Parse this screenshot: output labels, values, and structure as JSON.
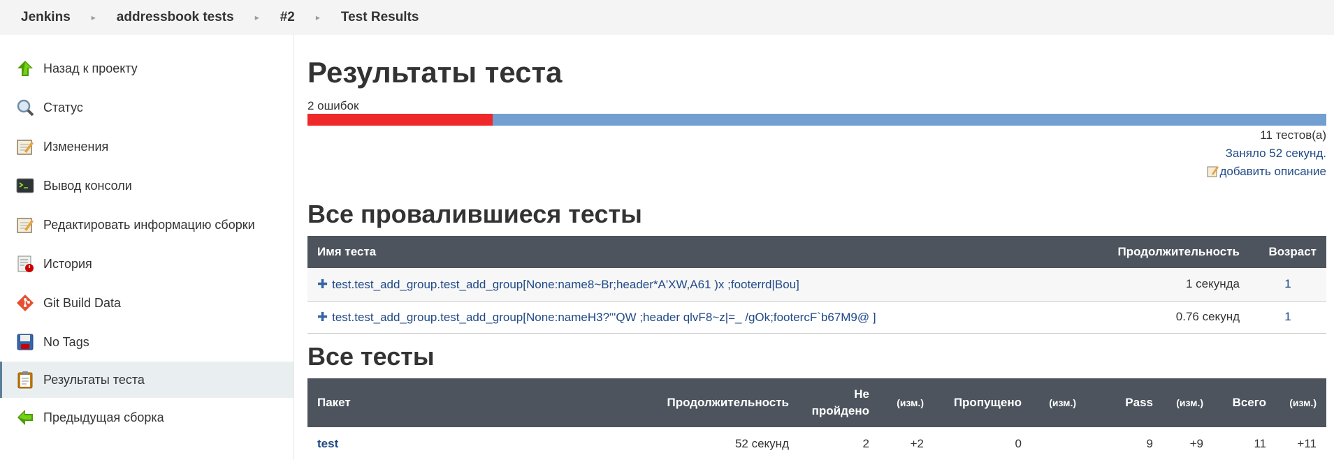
{
  "breadcrumb": {
    "items": [
      "Jenkins",
      "addressbook tests",
      "#2",
      "Test Results"
    ]
  },
  "sidebar": {
    "items": [
      {
        "label": "Назад к проекту",
        "icon": "up-arrow-icon"
      },
      {
        "label": "Статус",
        "icon": "magnifier-icon"
      },
      {
        "label": "Изменения",
        "icon": "notepad-icon"
      },
      {
        "label": "Вывод консоли",
        "icon": "terminal-icon"
      },
      {
        "label": "Редактировать информацию сборки",
        "icon": "notepad-icon"
      },
      {
        "label": "История",
        "icon": "history-icon"
      },
      {
        "label": "Git Build Data",
        "icon": "git-icon"
      },
      {
        "label": "No Tags",
        "icon": "save-icon"
      },
      {
        "label": "Результаты теста",
        "icon": "clipboard-icon"
      },
      {
        "label": "Предыдущая сборка",
        "icon": "left-arrow-icon"
      }
    ],
    "active_index": 8
  },
  "main": {
    "title": "Результаты теста",
    "fail_count_text": "2 ошибок",
    "progress": {
      "failed": 2,
      "total": 11,
      "fail_color": "#ef2929",
      "pass_color": "#729fcf"
    },
    "test_count": "11 тестов(а)",
    "duration": "Заняло 52 секунд.",
    "add_description": "добавить описание"
  },
  "failed_section": {
    "title": "Все провалившиеся тесты",
    "headers": {
      "name": "Имя теста",
      "duration": "Продолжительность",
      "age": "Возраст"
    },
    "rows": [
      {
        "name": "test.test_add_group.test_add_group[None:name8~Br;header*A'XW,A61 )x ;footerrd|Bou]",
        "duration": "1 секунда",
        "age": "1"
      },
      {
        "name": "test.test_add_group.test_add_group[None:nameH3?\"'QW ;header qlvF8~z|=_ /gOk;footercF`b67M9@ ]",
        "duration": "0.76 секунд",
        "age": "1"
      }
    ]
  },
  "all_section": {
    "title": "Все тесты",
    "headers": {
      "package": "Пакет",
      "duration": "Продолжительность",
      "failed_1": "Не",
      "failed_2": "пройдено",
      "diff1": "(изм.)",
      "skipped": "Пропущено",
      "diff2": "(изм.)",
      "pass": "Pass",
      "diff3": "(изм.)",
      "total": "Всего",
      "diff4": "(изм.)"
    },
    "rows": [
      {
        "package": "test",
        "duration": "52 секунд",
        "failed": "2",
        "failed_diff": "+2",
        "skipped": "0",
        "skipped_diff": "",
        "pass": "9",
        "pass_diff": "+9",
        "total": "11",
        "total_diff": "+11"
      }
    ]
  }
}
